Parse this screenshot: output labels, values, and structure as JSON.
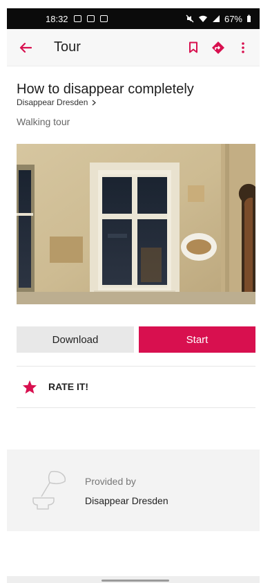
{
  "status_bar": {
    "time": "18:32",
    "battery": "67%",
    "icons": [
      "gallery-icon",
      "qr-icon",
      "screenshot-icon",
      "mute-icon",
      "wifi-icon",
      "signal-icon",
      "battery-icon"
    ]
  },
  "app_bar": {
    "title": "Tour",
    "icons": [
      "back-arrow-icon",
      "bookmark-icon",
      "directions-icon",
      "more-vert-icon"
    ]
  },
  "tour": {
    "title": "How to disappear completely",
    "publisher": "Disappear Dresden",
    "type": "Walking tour"
  },
  "actions": {
    "download_label": "Download",
    "start_label": "Start"
  },
  "rate": {
    "label": "RATE IT!",
    "icon": "star-icon"
  },
  "provider": {
    "provided_by_label": "Provided by",
    "name": "Disappear Dresden",
    "icon": "inkwell-quill-icon"
  },
  "colors": {
    "accent": "#d8104f",
    "secondary_button": "#e8e8e8",
    "status_bar": "#0b0b0b"
  }
}
